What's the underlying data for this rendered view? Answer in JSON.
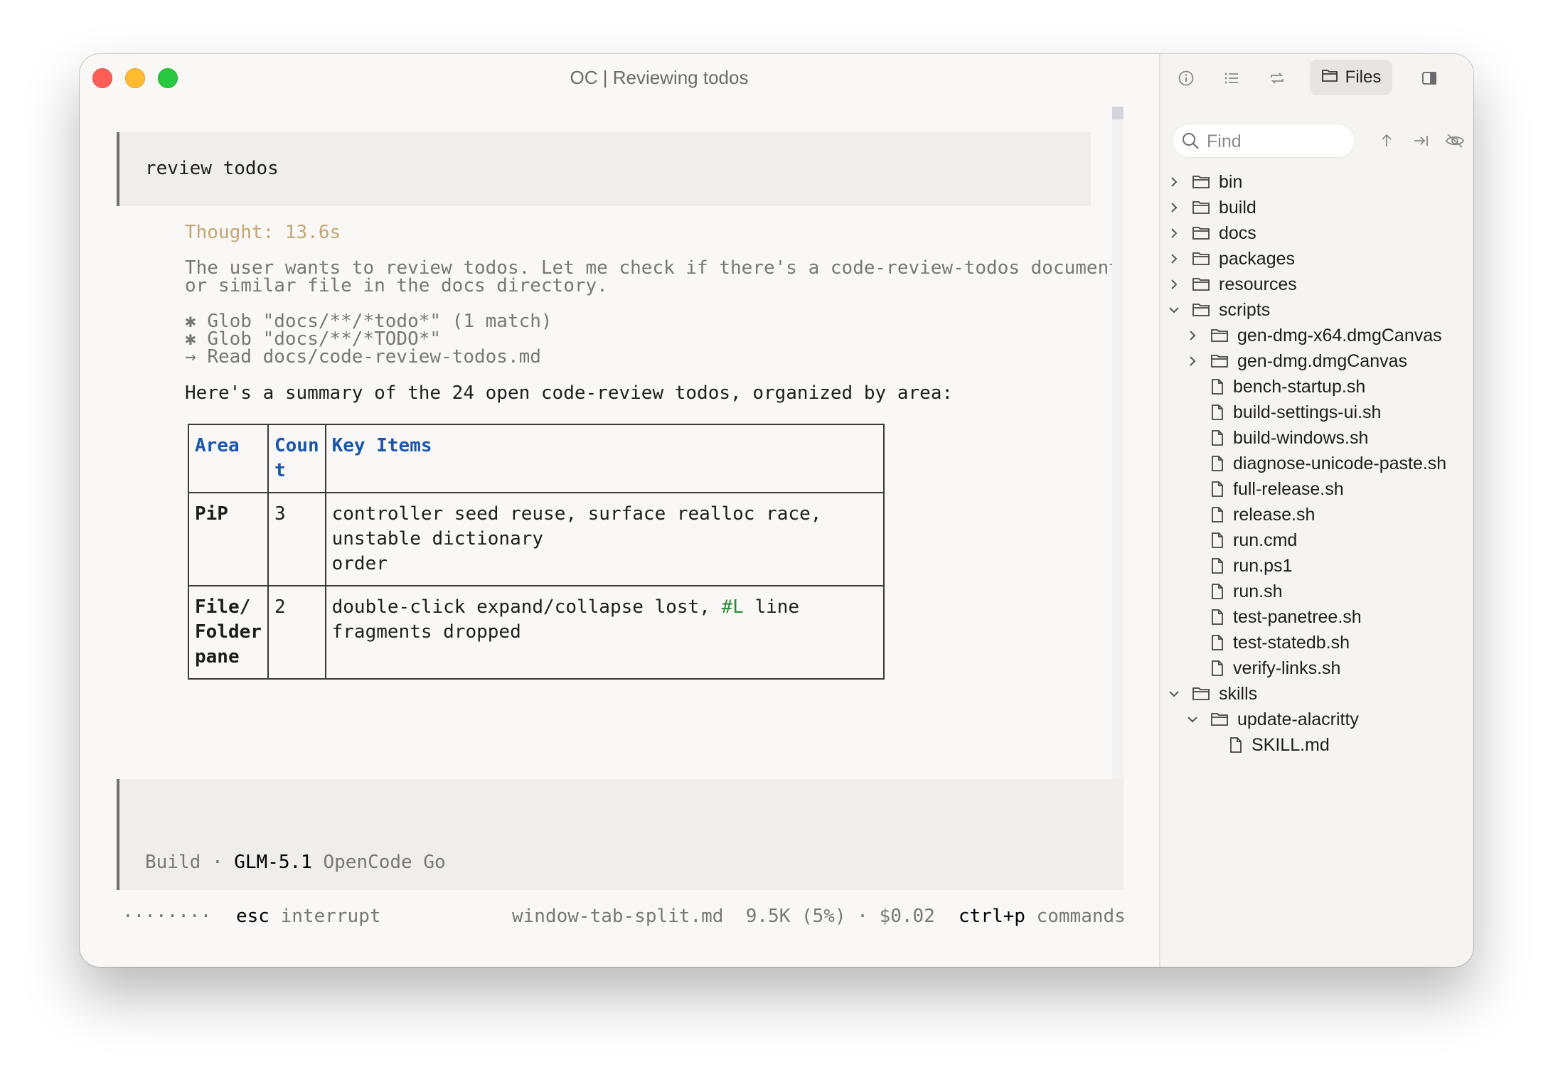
{
  "window": {
    "title": "OC | Reviewing todos"
  },
  "conversation": {
    "user_prompt": "review todos",
    "thought_label": "Thought: 13.6s",
    "reasoning": [
      "The user wants to review todos. Let me check if there's a code-review-todos document",
      "or similar file in the docs directory."
    ],
    "tool_calls": [
      {
        "marker": "✱",
        "text": "Glob \"docs/**/*todo*\" (1 match)"
      },
      {
        "marker": "✱",
        "text": "Glob \"docs/**/*TODO*\""
      },
      {
        "marker": "→",
        "text": "Read docs/code-review-todos.md"
      }
    ],
    "summary": "Here's a summary of the 24 open code-review todos, organized by area:",
    "table": {
      "headers": {
        "area": "Area",
        "count_a": "Coun",
        "count_b": "t",
        "items": "Key Items"
      },
      "rows": [
        {
          "area_a": "PiP",
          "area_b": "",
          "area_c": "",
          "count": "3",
          "items_a": "controller seed reuse, surface realloc race, unstable dictionary",
          "items_b": "order",
          "tag": "",
          "items_c": ""
        },
        {
          "area_a": "File/",
          "area_b": "Folder",
          "area_c": "pane",
          "count": "2",
          "items_a": "double-click expand/collapse lost, ",
          "tag": "#L",
          "items_c": " line fragments dropped",
          "items_b": ""
        }
      ]
    }
  },
  "input": {
    "mode": "Build",
    "separator": "·",
    "model": "GLM-5.1",
    "provider": "OpenCode Go"
  },
  "status_bar": {
    "spinner": "········",
    "interrupt_key": "esc",
    "interrupt_label": "interrupt",
    "file": "window-tab-split.md",
    "tokens": "9.5K (5%)",
    "sep": "·",
    "cost": "$0.02",
    "commands_key": "ctrl+p",
    "commands_label": "commands"
  },
  "sidebar": {
    "active_tab": "Files",
    "toolbar_icons": [
      "info-icon",
      "list-icon",
      "refresh-icon",
      "folder-icon",
      "sidebar-toggle-icon"
    ],
    "find_placeholder": "Find",
    "actions": [
      "arrow-up-icon",
      "reveal-icon",
      "eye-off-icon"
    ],
    "tree": [
      {
        "name": "bin",
        "type": "folder",
        "depth": 0,
        "expanded": false
      },
      {
        "name": "build",
        "type": "folder",
        "depth": 0,
        "expanded": false
      },
      {
        "name": "docs",
        "type": "folder",
        "depth": 0,
        "expanded": false
      },
      {
        "name": "packages",
        "type": "folder",
        "depth": 0,
        "expanded": false
      },
      {
        "name": "resources",
        "type": "folder",
        "depth": 0,
        "expanded": false
      },
      {
        "name": "scripts",
        "type": "folder",
        "depth": 0,
        "expanded": true
      },
      {
        "name": "gen-dmg-x64.dmgCanvas",
        "type": "folder",
        "depth": 1,
        "expanded": false
      },
      {
        "name": "gen-dmg.dmgCanvas",
        "type": "folder",
        "depth": 1,
        "expanded": false
      },
      {
        "name": "bench-startup.sh",
        "type": "file",
        "depth": 1
      },
      {
        "name": "build-settings-ui.sh",
        "type": "file",
        "depth": 1
      },
      {
        "name": "build-windows.sh",
        "type": "file",
        "depth": 1
      },
      {
        "name": "diagnose-unicode-paste.sh",
        "type": "file",
        "depth": 1
      },
      {
        "name": "full-release.sh",
        "type": "file",
        "depth": 1
      },
      {
        "name": "release.sh",
        "type": "file",
        "depth": 1
      },
      {
        "name": "run.cmd",
        "type": "file",
        "depth": 1
      },
      {
        "name": "run.ps1",
        "type": "file",
        "depth": 1
      },
      {
        "name": "run.sh",
        "type": "file",
        "depth": 1
      },
      {
        "name": "test-panetree.sh",
        "type": "file",
        "depth": 1
      },
      {
        "name": "test-statedb.sh",
        "type": "file",
        "depth": 1
      },
      {
        "name": "verify-links.sh",
        "type": "file",
        "depth": 1
      },
      {
        "name": "skills",
        "type": "folder",
        "depth": 0,
        "expanded": true
      },
      {
        "name": "update-alacritty",
        "type": "folder",
        "depth": 1,
        "expanded": true
      },
      {
        "name": "SKILL.md",
        "type": "file",
        "depth": 2
      }
    ]
  }
}
